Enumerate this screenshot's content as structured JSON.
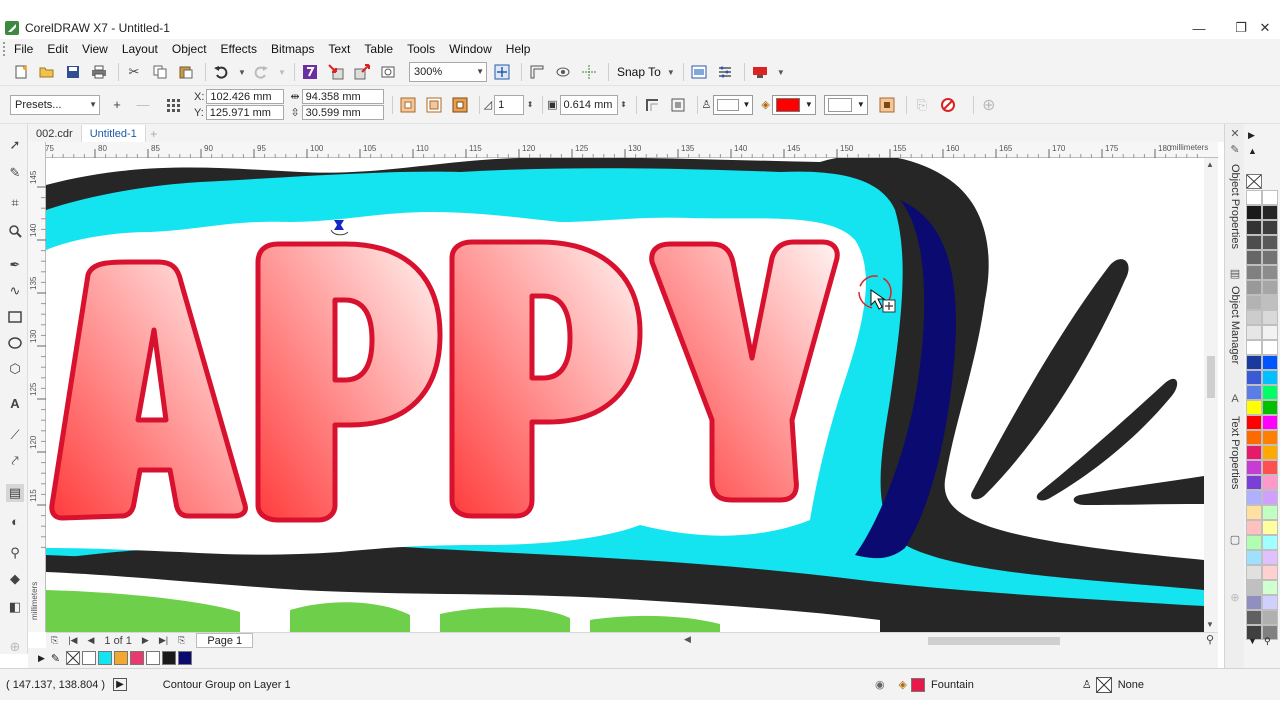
{
  "window": {
    "title": "CorelDRAW X7 - Untitled-1",
    "controls": [
      "—",
      "❐",
      "✕"
    ]
  },
  "menu": {
    "items": [
      "File",
      "Edit",
      "View",
      "Layout",
      "Object",
      "Effects",
      "Bitmaps",
      "Text",
      "Table",
      "Tools",
      "Window",
      "Help"
    ]
  },
  "standard_toolbar": {
    "zoom": "300%",
    "snap_to": "Snap To"
  },
  "property_bar": {
    "presets": "Presets...",
    "x": "102.426 mm",
    "y": "125.971 mm",
    "x_label": "X:",
    "y_label": "Y:",
    "width": "94.358 mm",
    "height": "30.599 mm",
    "steps": "1",
    "offset": "0.614 mm",
    "fill_color": "#ff0000"
  },
  "doc_tabs": [
    "002.cdr",
    "Untitled-1"
  ],
  "ruler": {
    "units": "millimeters",
    "h_ticks": [
      "75",
      "80",
      "85",
      "90",
      "95",
      "100",
      "105",
      "110",
      "115",
      "120",
      "125",
      "130",
      "135",
      "140",
      "145",
      "150",
      "155",
      "160",
      "165",
      "170",
      "175",
      "180"
    ],
    "v_ticks": [
      "145",
      "140",
      "135",
      "130",
      "125",
      "120",
      "115"
    ],
    "v_units": "millimeters"
  },
  "page_nav": {
    "page_count": "1 of 1",
    "page_tab": "Page 1"
  },
  "document_palette": {
    "colors": [
      "#ffffff",
      "#13e4f0",
      "#f0a830",
      "#e83a6e",
      "#ffffff",
      "#1a1a1a",
      "#0a0a70"
    ]
  },
  "status": {
    "coords": "( 147.137, 138.804 )",
    "object_info": "Contour Group on Layer 1",
    "fill_label": "Fountain",
    "fill_color": "#e8194a",
    "outline_label": "None"
  },
  "dockers": [
    "Object Properties",
    "Object Manager",
    "Text Properties"
  ],
  "palette": {
    "col1": [
      "#ffffff",
      "#1a1a1a",
      "#333333",
      "#4d4d4d",
      "#666666",
      "#808080",
      "#999999",
      "#b3b3b3",
      "#cccccc",
      "#e6e6e6",
      "#ffffff",
      "#1b3a9e",
      "#3b5bd6",
      "#5a7de6",
      "#ffff00",
      "#ff0000",
      "#ff6a00",
      "#e6196b",
      "#c83cd6",
      "#7a3fd6",
      "#b0b0ff",
      "#ffe0a0",
      "#ffc0c0",
      "#b0ffb0",
      "#a0e0ff",
      "#e0e0e0",
      "#c0c0c0",
      "#9090c0",
      "#606060",
      "#404040"
    ],
    "col2": [
      "#ffffff",
      "#262626",
      "#3d3d3d",
      "#595959",
      "#737373",
      "#8c8c8c",
      "#a6a6a6",
      "#bfbfbf",
      "#d9d9d9",
      "#f2f2f2",
      "#ffffff",
      "#0055ff",
      "#00c0ff",
      "#00ff66",
      "#00c000",
      "#ff00ff",
      "#ff8000",
      "#ffaa00",
      "#ff5050",
      "#ff99cc",
      "#d0a0ff",
      "#c0ffc0",
      "#ffffa0",
      "#a0ffff",
      "#e0c0ff",
      "#ffd0d0",
      "#d0ffd0",
      "#d0d0ff",
      "#b0b0b0",
      "#808080"
    ]
  },
  "artwork": {
    "headline": "APPY",
    "colors": {
      "outer_stroke": "#262626",
      "cyan_contour": "#13e4f0",
      "navy_shadow": "#0a0a70",
      "white_contour": "#ffffff",
      "letter_outline": "#d8112f",
      "gradient_start": "#ff3c3c",
      "gradient_end": "#fff4f2",
      "green_text": "#6ed04a"
    }
  }
}
